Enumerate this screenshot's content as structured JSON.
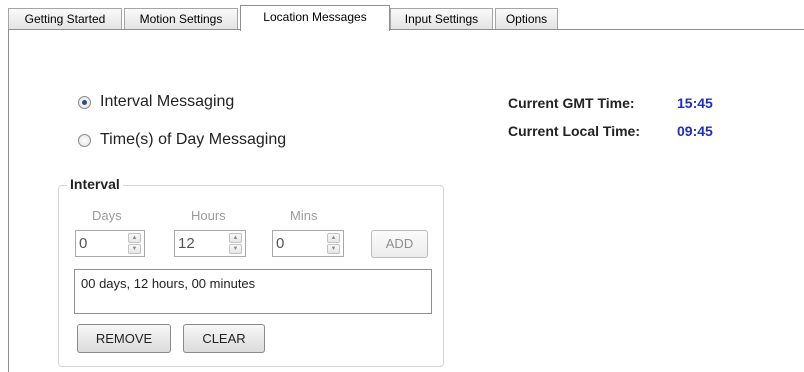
{
  "tabs": [
    {
      "label": "Getting Started"
    },
    {
      "label": "Motion Settings"
    },
    {
      "label": "Location Messages"
    },
    {
      "label": "Input Settings"
    },
    {
      "label": "Options"
    }
  ],
  "messaging": {
    "interval_label": "Interval Messaging",
    "time_of_day_label": "Time(s) of Day Messaging",
    "selected": "Interval Messaging"
  },
  "times": {
    "gmt_label": "Current GMT Time:",
    "gmt_value": "15:45",
    "local_label": "Current Local Time:",
    "local_value": "09:45",
    "value_color": "#1f2ec2"
  },
  "interval": {
    "title": "Interval",
    "days_label": "Days",
    "days_value": "0",
    "hours_label": "Hours",
    "hours_value": "12",
    "mins_label": "Mins",
    "mins_value": "0",
    "add_label": "ADD",
    "list_items": [
      "00 days, 12 hours, 00 minutes"
    ],
    "remove_label": "REMOVE",
    "clear_label": "CLEAR"
  },
  "icons": {
    "spin_up": "arrow-up-icon",
    "spin_down": "arrow-down-icon"
  }
}
